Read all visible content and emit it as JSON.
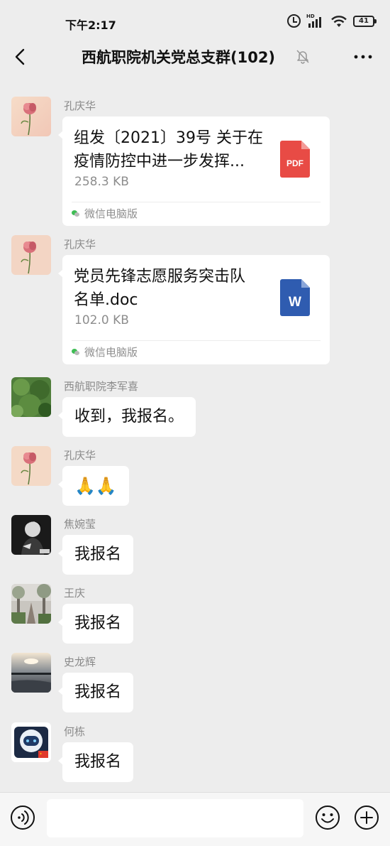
{
  "status_bar": {
    "time": "下午2:17",
    "network_badge": "HD",
    "battery": "41",
    "icons": [
      "alarm-icon",
      "signal-icon",
      "wifi-icon",
      "battery-icon"
    ]
  },
  "header": {
    "title": "西航职院机关党总支群(102)",
    "icons": [
      "back-arrow-icon",
      "mute-bell-icon",
      "more-dots-icon"
    ]
  },
  "messages": [
    {
      "sender": "孔庆华",
      "type": "file",
      "file_title_line1": "组发〔2021〕39号 关于在",
      "file_title_line2": "疫情防控中进一步发挥...",
      "file_size": "258.3 KB",
      "file_icon_label": "PDF",
      "file_icon_color": "#e84b45",
      "source": "微信电脑版"
    },
    {
      "sender": "孔庆华",
      "type": "file",
      "file_title_line1": "党员先锋志愿服务突击队",
      "file_title_line2": "名单.doc",
      "file_size": "102.0 KB",
      "file_icon_label": "W",
      "file_icon_color": "#2f5cb0",
      "source": "微信电脑版"
    },
    {
      "sender": "西航职院李军喜",
      "type": "text",
      "text": "收到，我报名。"
    },
    {
      "sender": "孔庆华",
      "type": "emoji",
      "text": "🙏🙏"
    },
    {
      "sender": "焦婉莹",
      "type": "text",
      "text": "我报名"
    },
    {
      "sender": "王庆",
      "type": "text",
      "text": "我报名"
    },
    {
      "sender": "史龙辉",
      "type": "text",
      "text": "我报名"
    },
    {
      "sender": "何栋",
      "type": "text",
      "text": "我报名"
    }
  ],
  "input_bar": {
    "placeholder": "",
    "icons": [
      "voice-icon",
      "emoji-icon",
      "plus-icon"
    ]
  },
  "colors": {
    "background": "#ededed",
    "bubble": "#ffffff",
    "sender_name": "#8a8a8a",
    "wechat_green": "#3fbd55"
  }
}
